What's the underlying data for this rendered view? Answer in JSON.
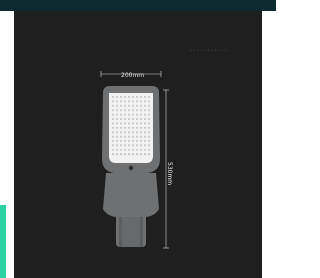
{
  "colors": {
    "header_bar": "#0d2a30",
    "side_accent": "#2bd3a0",
    "photo_background": "#1f1f1f",
    "fixture_body": "#6f7072",
    "led_panel": "#f2f2f2",
    "dimension_lines": "#d8d8d8"
  },
  "dimensions": {
    "width_label": "200mm",
    "height_label": "530mm"
  },
  "watermark": {
    "text": "• • • • • • • • • • •"
  },
  "product": {
    "icon": "led-street-light-icon"
  }
}
